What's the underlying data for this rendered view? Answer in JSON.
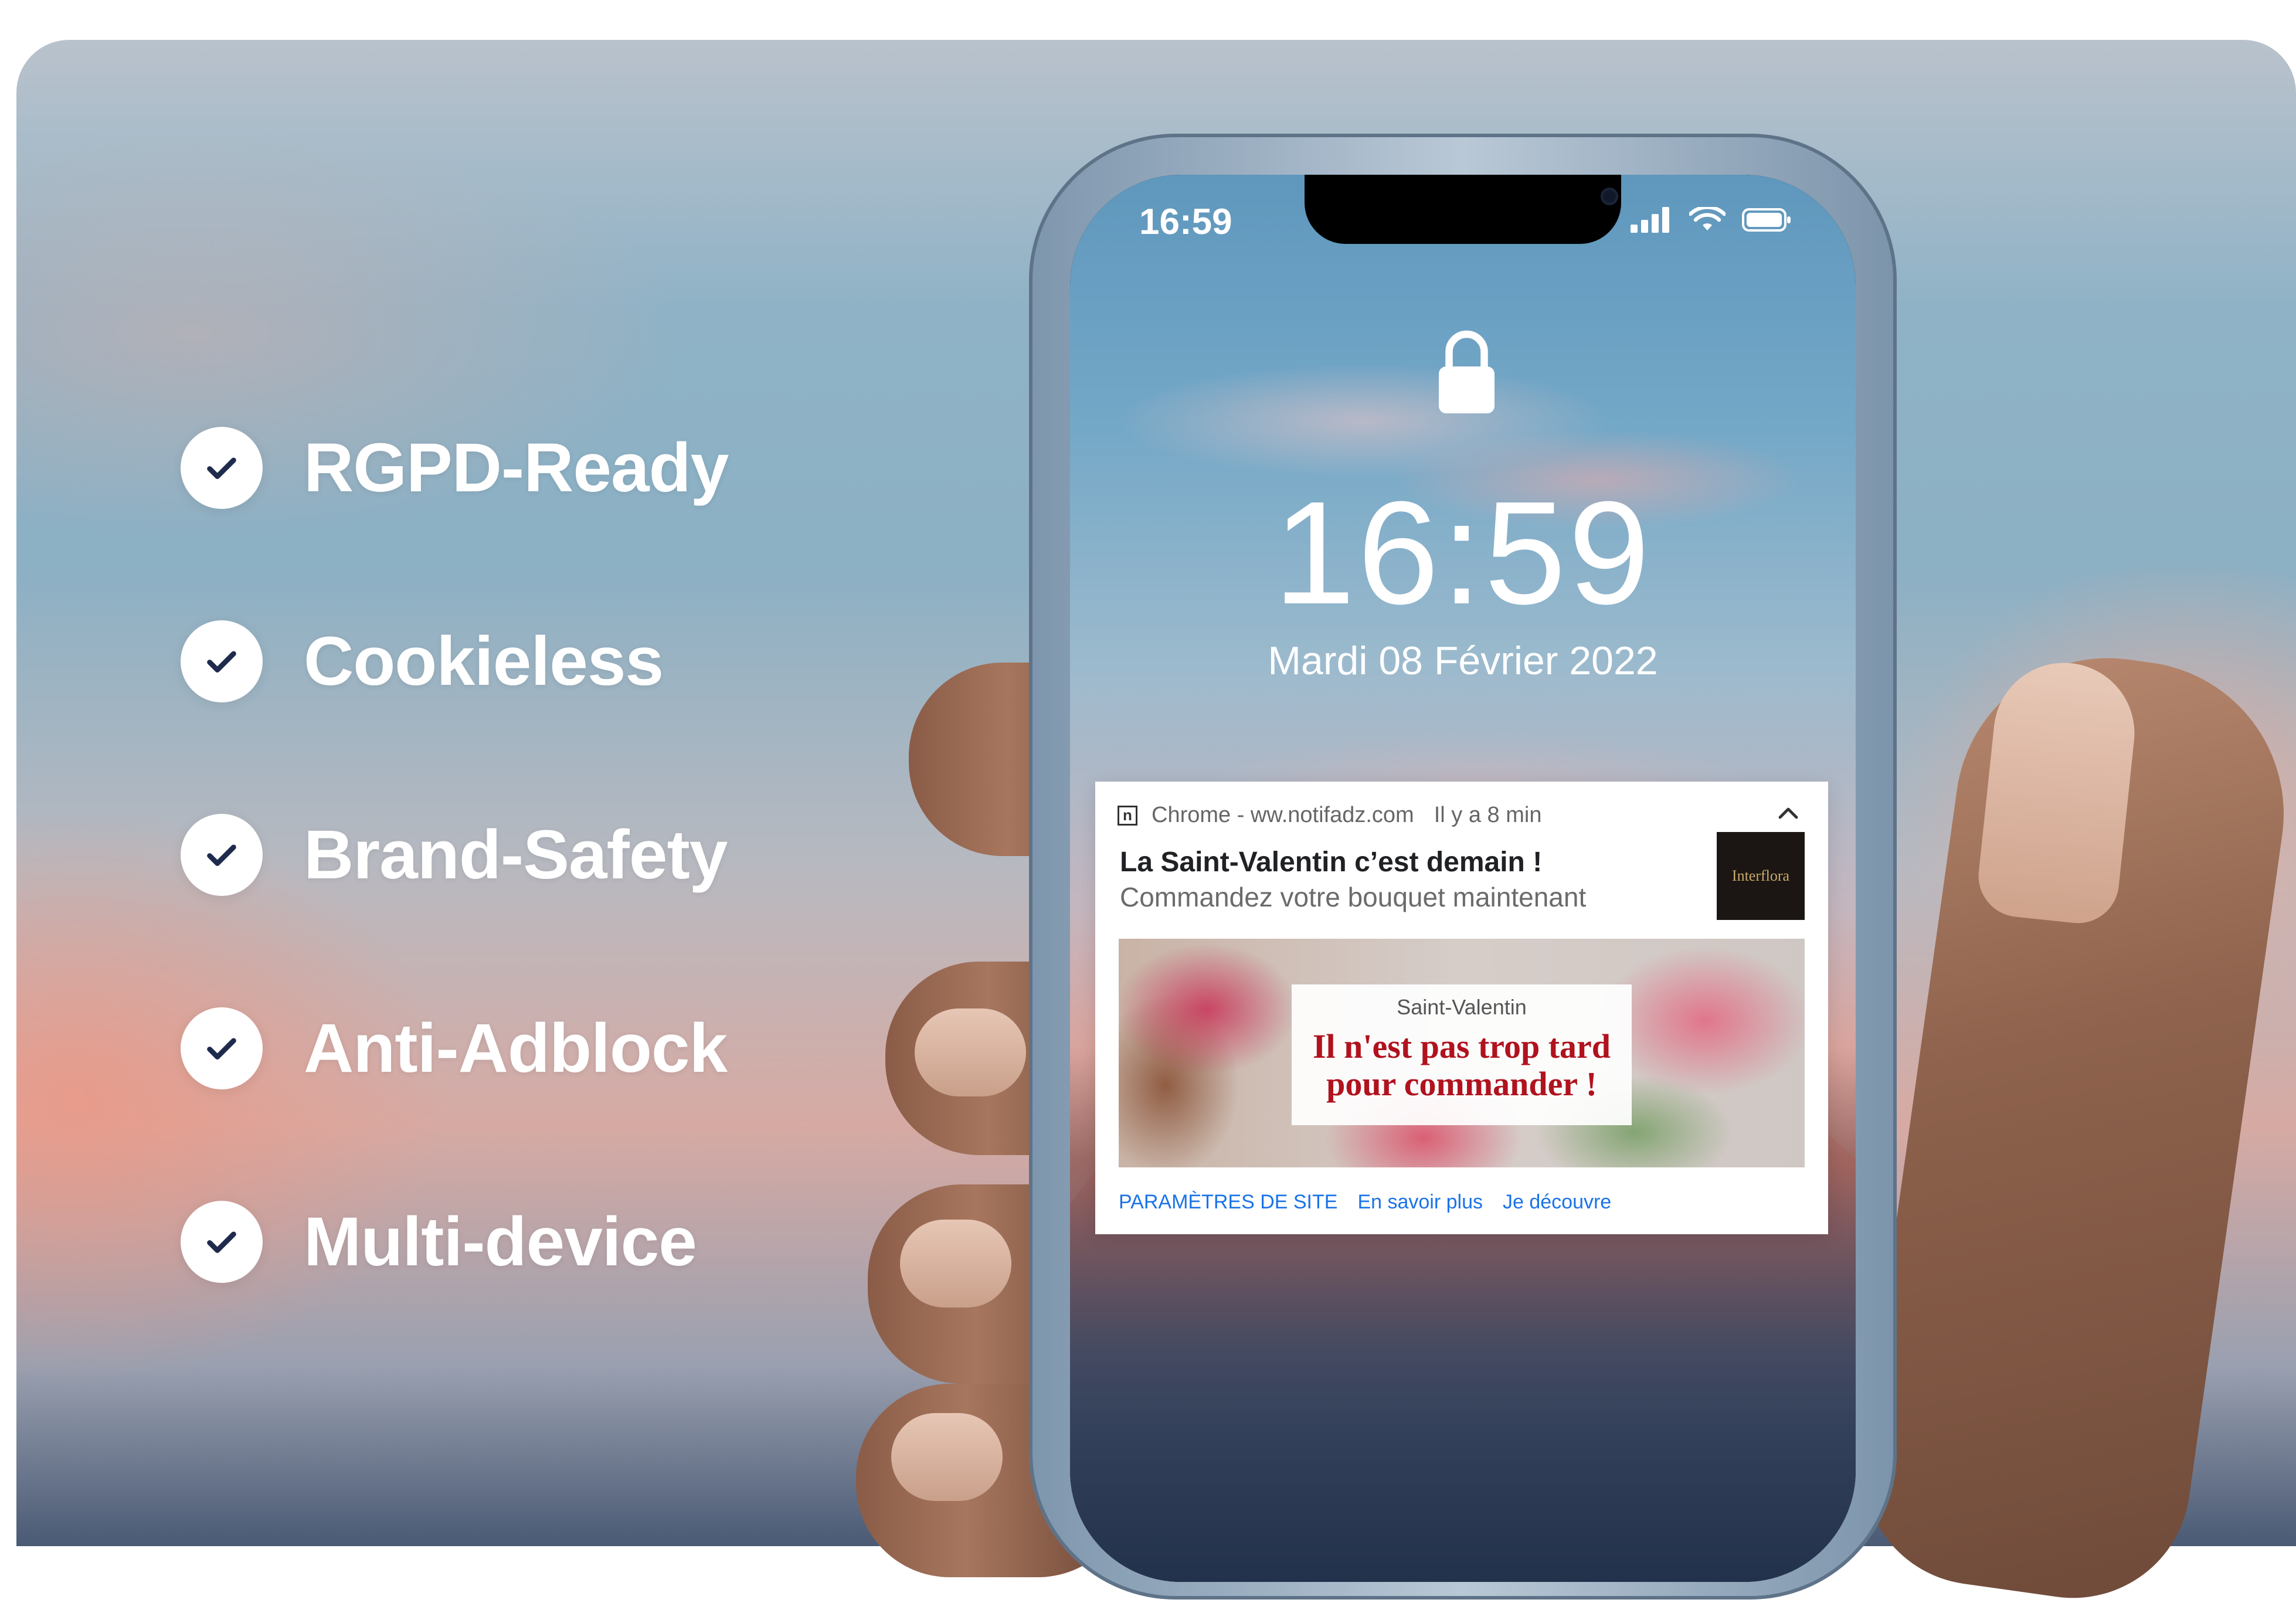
{
  "features": [
    {
      "label": "RGPD-Ready"
    },
    {
      "label": "Cookieless"
    },
    {
      "label": "Brand-Safety"
    },
    {
      "label": "Anti-Adblock"
    },
    {
      "label": "Multi-device"
    }
  ],
  "phone": {
    "status_time": "16:59",
    "lock_time": "16:59",
    "lock_date": "Mardi 08 Février 2022",
    "status_icons": [
      "signal-icon",
      "wifi-icon",
      "battery-icon"
    ]
  },
  "notification": {
    "app_icon_letter": "n",
    "source": "Chrome - ww.notifadz.com",
    "time": "Il y a 8 min",
    "title": "La Saint-Valentin c’est demain !",
    "body": "Commandez votre bouquet maintenant",
    "logo_text": "Interflora",
    "banner": {
      "subtitle": "Saint-Valentin",
      "line1": "Il n'est pas trop tard",
      "line2": "pour commander !"
    },
    "actions": {
      "site_settings": "PARAMÈTRES DE SITE",
      "learn_more": "En savoir plus",
      "discover": "Je découvre"
    }
  },
  "colors": {
    "check_mark": "#1f2b4d",
    "action_link": "#1a73e8",
    "banner_headline": "#b0121e"
  }
}
